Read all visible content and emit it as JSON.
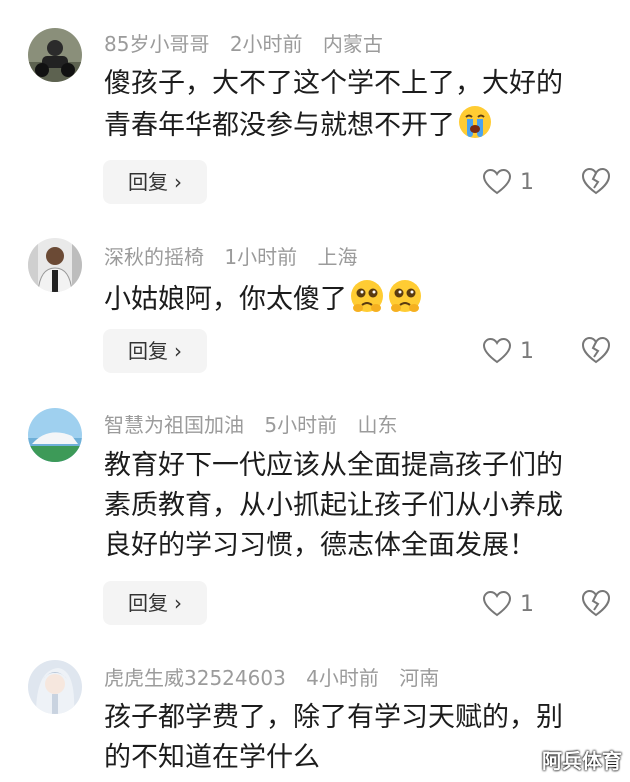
{
  "comments": [
    {
      "username": "85岁小哥哥",
      "time": "2小时前",
      "location": "内蒙古",
      "text_lines": [
        "傻孩子，大不了这个学不上了，大好的",
        "青春年华都没参与就想不开了"
      ],
      "emoji": "crying-face",
      "reply_label": "回复",
      "like_count": "1"
    },
    {
      "username": "深秋的摇椅",
      "time": "1小时前",
      "location": "上海",
      "text_lines": [
        "小姑娘阿，你太傻了"
      ],
      "emoji": "pleading-face",
      "reply_label": "回复",
      "like_count": "1"
    },
    {
      "username": "智慧为祖国加油",
      "time": "5小时前",
      "location": "山东",
      "text_lines": [
        "教育好下一代应该从全面提高孩子们的",
        "素质教育，从小抓起让孩子们从小养成",
        "良好的学习习惯，德志体全面发展！"
      ],
      "reply_label": "回复",
      "like_count": "1"
    },
    {
      "username": "虎虎生威32524603",
      "time": "4小时前",
      "location": "河南",
      "text_lines": [
        "孩子都学费了，除了有学习天赋的，别",
        "的不知道在学什么"
      ]
    }
  ],
  "watermark": "阿兵体育",
  "colors": {
    "meta": "#9b9b9b",
    "text": "#1c1c1c",
    "reply_bg": "#f4f4f4"
  }
}
